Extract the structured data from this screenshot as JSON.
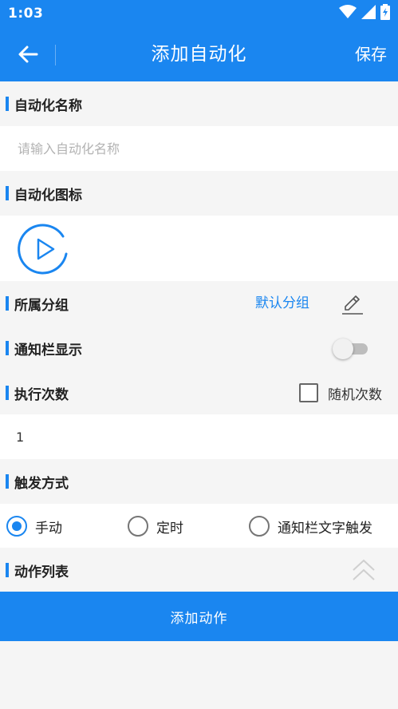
{
  "status_bar": {
    "time": "1:03",
    "icons": [
      "wifi-icon",
      "signal-icon",
      "battery-charging-icon"
    ]
  },
  "app_bar": {
    "title": "添加自动化",
    "save_label": "保存",
    "back_icon": "arrow-left-icon"
  },
  "sections": {
    "name": {
      "label": "自动化名称",
      "placeholder": "请输入自动化名称",
      "value": ""
    },
    "icon": {
      "label": "自动化图标",
      "icon": "play-circle-icon"
    },
    "group": {
      "label": "所属分组",
      "value": "默认分组",
      "edit_icon": "pencil-icon"
    },
    "notification": {
      "label": "通知栏显示",
      "enabled": false
    },
    "exec_count": {
      "label": "执行次数",
      "value": "1",
      "random_label": "随机次数",
      "random_checked": false
    },
    "trigger": {
      "label": "触发方式",
      "options": [
        {
          "label": "手动",
          "checked": true
        },
        {
          "label": "定时",
          "checked": false
        },
        {
          "label": "通知栏文字触发",
          "checked": false
        }
      ]
    },
    "actions": {
      "label": "动作列表",
      "collapse_icon": "double-chevron-up-icon"
    }
  },
  "add_action": {
    "label": "添加动作"
  },
  "colors": {
    "primary": "#1a86f0",
    "background": "#f5f5f5",
    "row": "#ffffff",
    "placeholder": "#b3b3b3"
  }
}
